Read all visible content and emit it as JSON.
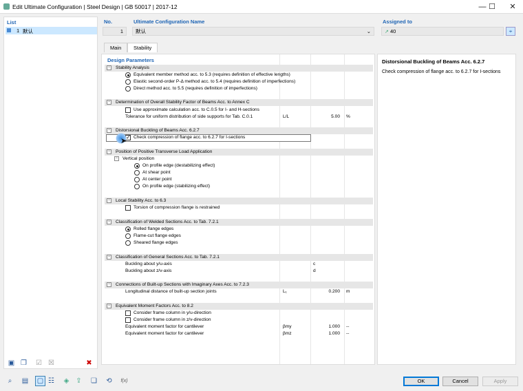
{
  "window": {
    "title": "Edit Ultimate Configuration | Steel Design | GB 50017 | 2017-12",
    "minimize": "—",
    "maximize": "☐",
    "close": "✕"
  },
  "list": {
    "header": "List",
    "items": [
      {
        "no": "1",
        "name": "默认"
      }
    ]
  },
  "fields": {
    "no_label": "No.",
    "no_value": "1",
    "name_label": "Ultimate Configuration Name",
    "name_value": "默认",
    "assigned_label": "Assigned to",
    "assigned_value": "40"
  },
  "tabs": [
    {
      "label": "Main"
    },
    {
      "label": "Stability"
    }
  ],
  "grid": {
    "header": "Design Parameters",
    "sections": [
      {
        "title": "Stability Analysis",
        "rows": [
          "Equivalent member method acc. to 5.3 (requires definition of effective lengths)",
          "Elastic second-order P-Δ method acc. to 5.4 (requires definition of imperfections)",
          "Direct method acc. to 5.5 (requires definition of imperfections)"
        ]
      },
      {
        "title": "Determination of Overall Stability Factor of Beams Acc. to Annex C",
        "rows": [
          "Use approximate calculation acc. to C.0.5 for I- and H-sections",
          "Tolerance for uniform distribution of side supports for Tab. C.0.1"
        ],
        "tol_symbol": "L/L",
        "tol_value": "5.00",
        "tol_unit": "%"
      },
      {
        "title": "Distorsional Buckling of Beams Acc. 6.2.7",
        "rows": [
          "Check compression of flange acc. to 6.2.7 for I-sections"
        ]
      },
      {
        "title": "Position of Positive Transverse Load Application",
        "sub": "Vertical position",
        "rows": [
          "On profile edge (destabilizing effect)",
          "At shear point",
          "At center point",
          "On profile edge (stabilizing effect)"
        ]
      },
      {
        "title": "Local Stability Acc. to 6.3",
        "rows": [
          "Torsion of compression flange is restrained"
        ]
      },
      {
        "title": "Classification of Welded Sections Acc. to Tab. 7.2.1",
        "rows": [
          "Rolled flange edges",
          "Flame-cut flange edges",
          "Sheared flange edges"
        ]
      },
      {
        "title": "Classification of General Sections Acc. to Tab. 7.2.1",
        "rows": [
          "Buckling about y/u-axis",
          "Buckling about z/v-axis"
        ],
        "vals": [
          "c",
          "d"
        ]
      },
      {
        "title": "Connections of Built-up Sections with Imaginary Axes Acc. to 7.2.3",
        "rows": [
          "Longitudinal distance of built-up section joints"
        ],
        "symbol": "L₁",
        "value": "0.200",
        "unit": "m"
      },
      {
        "title": "Equivalent Moment Factors Acc. to 8.2",
        "rows": [
          "Consider frame column in y/u-direction",
          "Consider frame column in z/v-direction",
          "Equivalent moment factor for cantilever",
          "Equivalent moment factor for cantilever"
        ],
        "symbols": [
          "βmy",
          "βmz"
        ],
        "values": [
          "1.000",
          "1.000"
        ],
        "units": [
          "--",
          "--"
        ]
      }
    ]
  },
  "info": {
    "title": "Distorsional Buckling of Beams Acc. 6.2.7",
    "text": "Check compression of flange acc. to 6.2.7 for I-sections"
  },
  "buttons": {
    "ok": "OK",
    "cancel": "Cancel",
    "apply": "Apply"
  },
  "icons": {
    "delete": "✖",
    "fx": "f(x)"
  }
}
